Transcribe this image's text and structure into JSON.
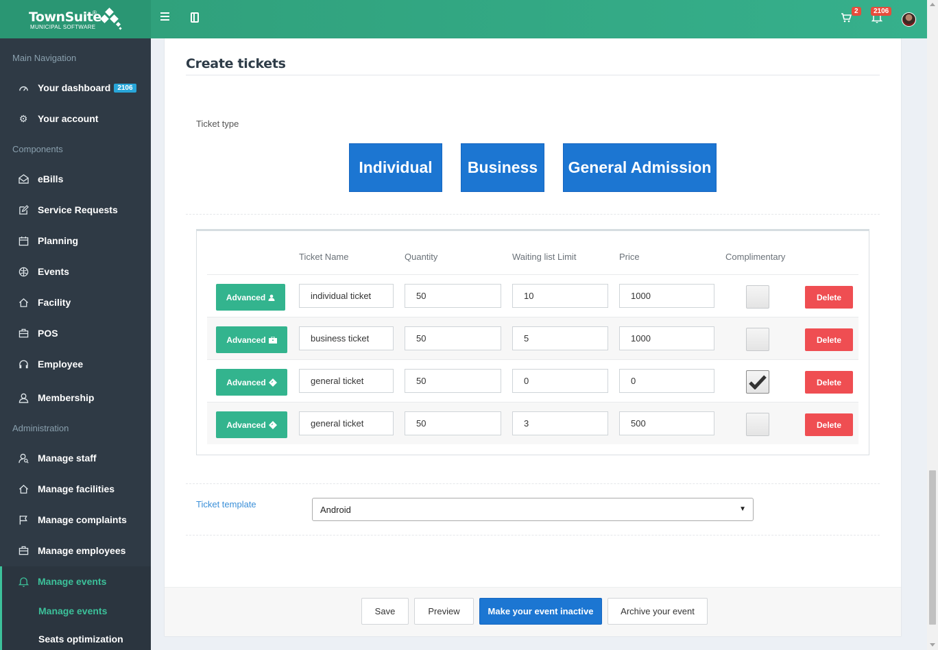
{
  "header": {
    "logo_title": "TownSuite",
    "logo_reg": "®",
    "logo_subtitle": "MUNICIPAL SOFTWARE",
    "cart_count": "2",
    "notification_count": "2106"
  },
  "sidebar": {
    "section_main": "Main Navigation",
    "dashboard_label": "Your dashboard",
    "dashboard_badge": "2106",
    "account_label": "Your account",
    "section_components": "Components",
    "components": [
      {
        "label": "eBills",
        "icon": "envelope-open-icon"
      },
      {
        "label": "Service Requests",
        "icon": "edit-icon"
      },
      {
        "label": "Planning",
        "icon": "calendar-icon"
      },
      {
        "label": "Events",
        "icon": "globe-icon"
      },
      {
        "label": "Facility",
        "icon": "home-icon"
      },
      {
        "label": "POS",
        "icon": "briefcase-icon"
      },
      {
        "label": "Employee",
        "icon": "headset-icon"
      },
      {
        "label": "Membership",
        "icon": "user-icon"
      }
    ],
    "section_admin": "Administration",
    "admin": [
      {
        "label": "Manage staff",
        "icon": "user-search-icon"
      },
      {
        "label": "Manage facilities",
        "icon": "home-icon"
      },
      {
        "label": "Manage complaints",
        "icon": "flag-icon"
      },
      {
        "label": "Manage employees",
        "icon": "briefcase-icon"
      },
      {
        "label": "Manage events",
        "icon": "bell-icon"
      }
    ],
    "sub_items": [
      "Manage events",
      "Seats optimization"
    ]
  },
  "content": {
    "page_title": "Create tickets",
    "ticket_type_label": "Ticket type",
    "ticket_types": [
      "Individual",
      "Business",
      "General Admission"
    ],
    "table_headers": [
      "Ticket Name",
      "Quantity",
      "Waiting list Limit",
      "Price",
      "Complimentary"
    ],
    "rows": [
      {
        "advanced": "Advanced",
        "icon": "user-icon",
        "name": "individual ticket",
        "quantity": "50",
        "waiting": "10",
        "price": "1000",
        "complimentary": false,
        "delete": "Delete"
      },
      {
        "advanced": "Advanced",
        "icon": "briefcase-icon",
        "name": "business ticket",
        "quantity": "50",
        "waiting": "5",
        "price": "1000",
        "complimentary": false,
        "delete": "Delete"
      },
      {
        "advanced": "Advanced",
        "icon": "ticket-icon",
        "name": "general ticket",
        "quantity": "50",
        "waiting": "0",
        "price": "0",
        "complimentary": true,
        "delete": "Delete"
      },
      {
        "advanced": "Advanced",
        "icon": "ticket-icon",
        "name": "general ticket",
        "quantity": "50",
        "waiting": "3",
        "price": "500",
        "complimentary": false,
        "delete": "Delete"
      }
    ],
    "template_label": "Ticket template",
    "template_value": "Android"
  },
  "footer": {
    "save": "Save",
    "preview": "Preview",
    "inactive": "Make your event inactive",
    "archive": "Archive your event"
  },
  "colors": {
    "brand_green": "#36b08c",
    "primary_blue": "#1c76d2",
    "danger_red": "#ef4e52",
    "sidebar_bg": "#2f3a45"
  }
}
